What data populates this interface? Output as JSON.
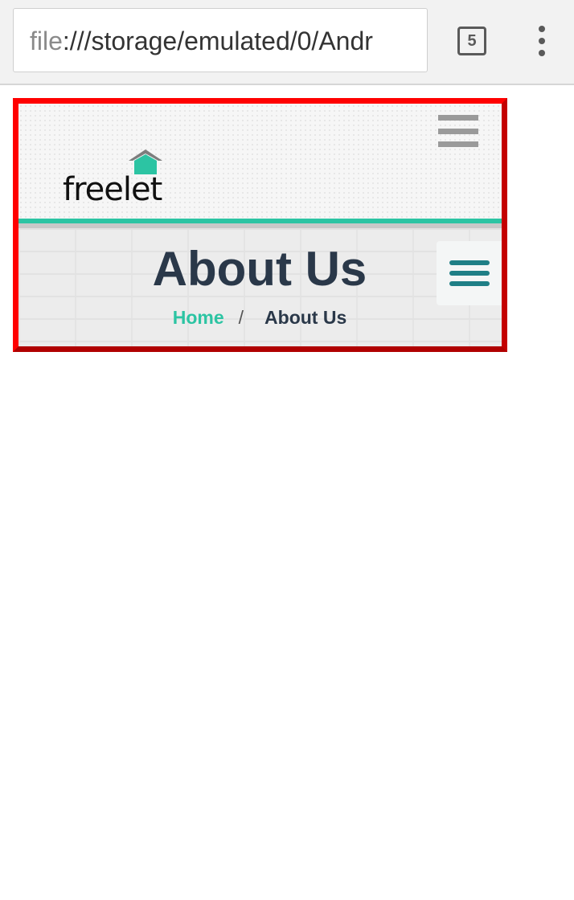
{
  "browser": {
    "url_scheme": "file",
    "url_rest": ":///storage/emulated/0/Andr",
    "tab_count": "5",
    "icons": {
      "tabs": "tab-switcher-icon",
      "menu": "overflow-menu-icon"
    }
  },
  "site": {
    "logo_text": "freelet",
    "brand_color": "#2cc4a3",
    "title_color": "#2a3849"
  },
  "banner": {
    "title": "About Us",
    "breadcrumb": {
      "home": "Home",
      "separator": "/",
      "current": "About Us"
    }
  }
}
